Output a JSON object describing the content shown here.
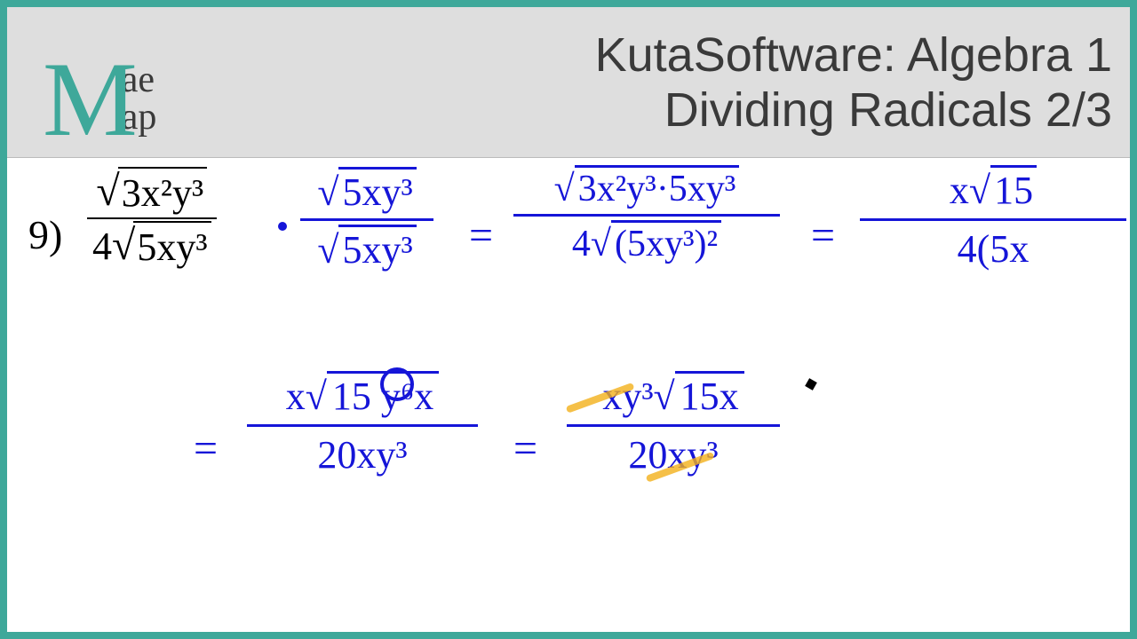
{
  "header": {
    "logo_big": "M",
    "logo_top": "ae",
    "logo_bottom": "ap",
    "title_line1": "KutaSoftware: Algebra 1",
    "title_line2": "Dividing Radicals 2/3"
  },
  "problem": {
    "number": "9)",
    "printed": {
      "numerator_radicand": "3x²y³",
      "denominator_coef": "4",
      "denominator_radicand": "5xy³"
    },
    "steps": {
      "mult_num": "5xy³",
      "mult_den": "5xy³",
      "eq1": "=",
      "step2_num": "3x²y³·5xy³",
      "step2_den_coef": "4",
      "step2_den_rad": "(5xy³)²",
      "eq2": "=",
      "step3_num_x": "x",
      "step3_num_rad": "15",
      "step3_den": "4(5x",
      "row2_eq1": "=",
      "row2a_num_x": "x",
      "row2a_num_rad": "15 y⁶x",
      "row2a_den": "20xy³",
      "row2_eq2": "=",
      "row2b_num": "xy³",
      "row2b_num_rad": "15x",
      "row2b_den": "20xy³"
    }
  }
}
